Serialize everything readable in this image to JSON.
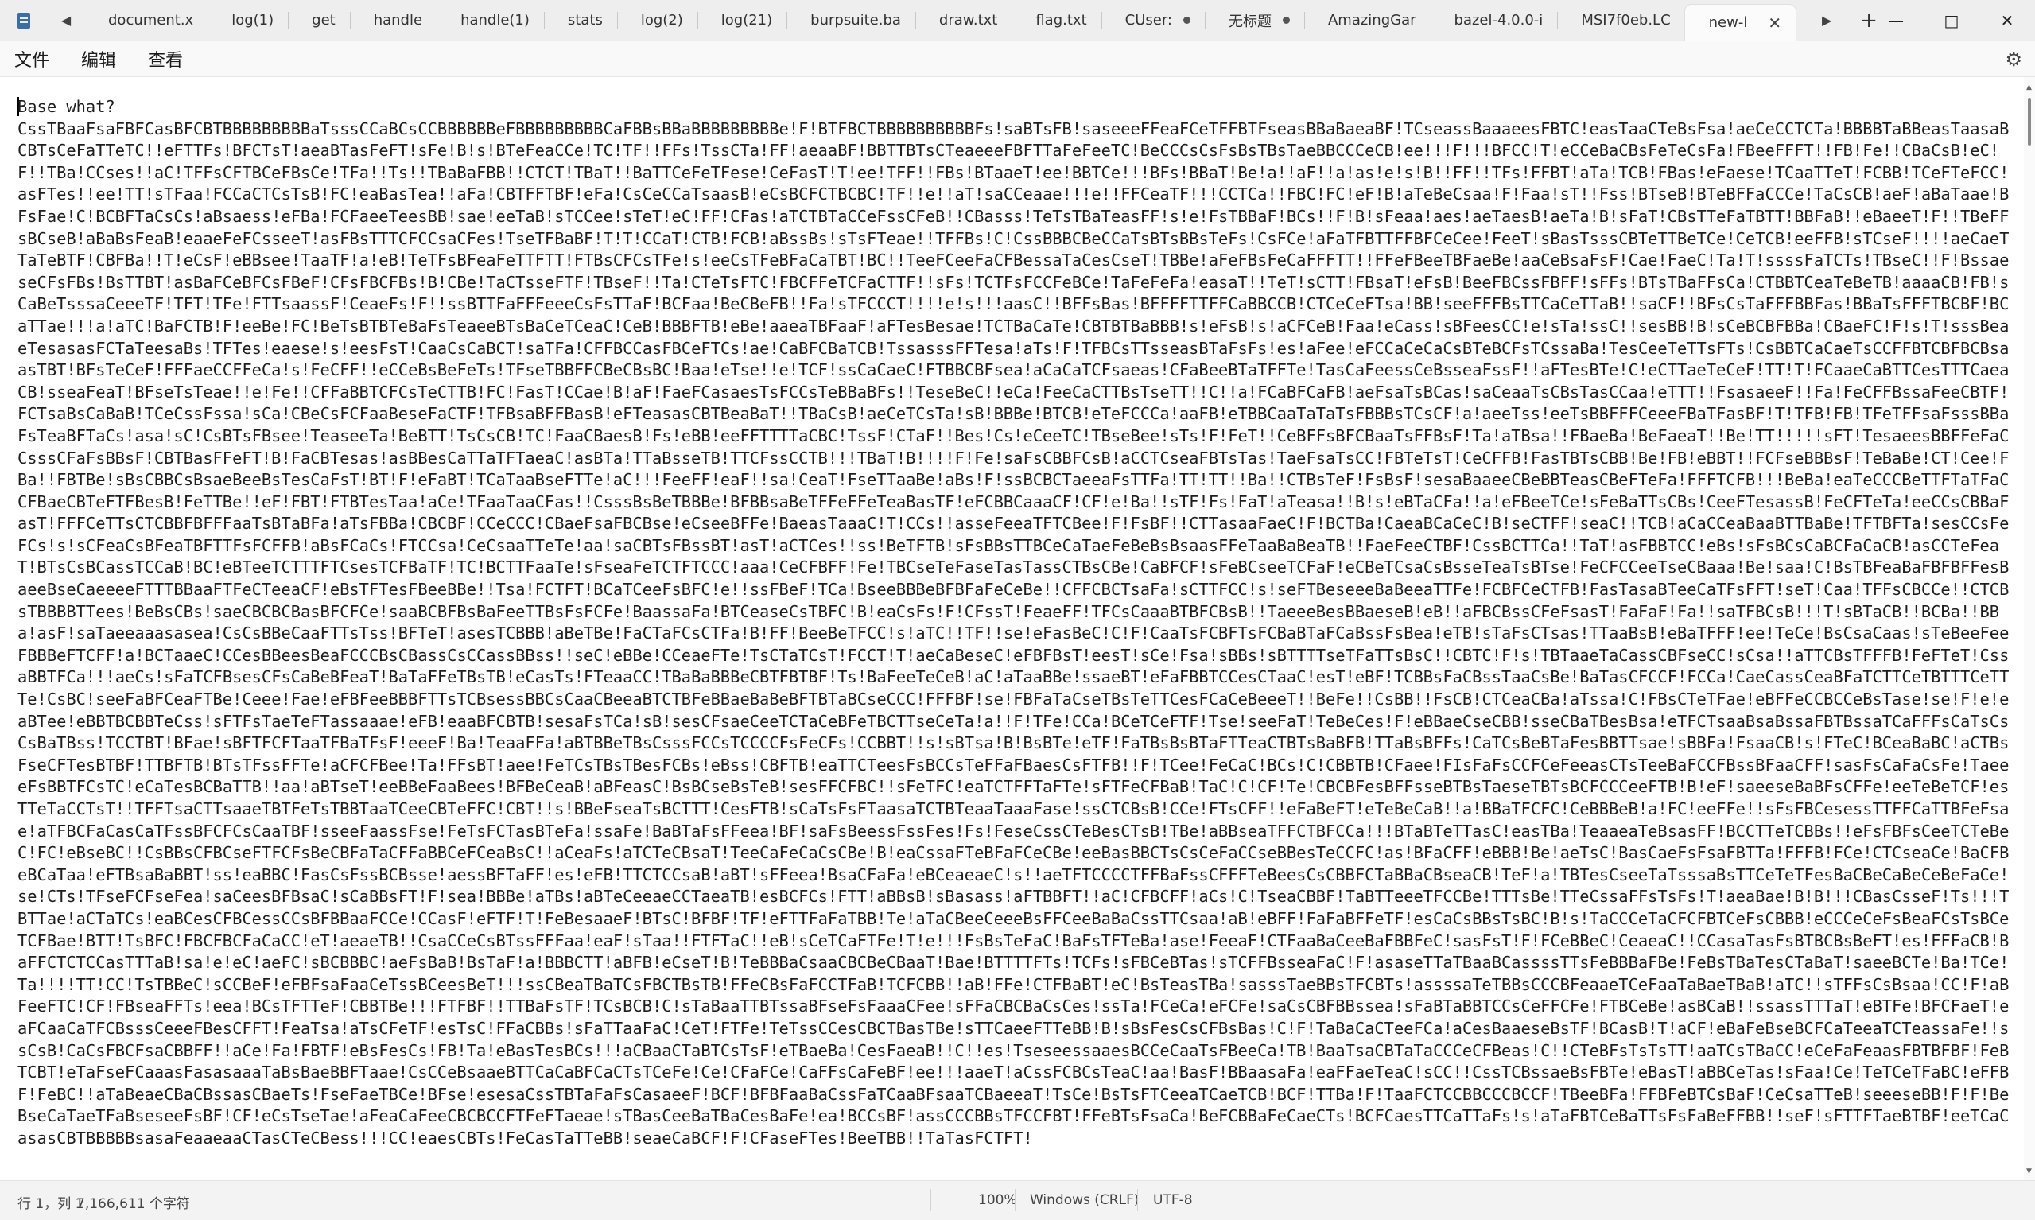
{
  "tabs": [
    {
      "label": "document.x",
      "modified": false
    },
    {
      "label": "log(1)",
      "modified": false
    },
    {
      "label": "get",
      "modified": false
    },
    {
      "label": "handle",
      "modified": false
    },
    {
      "label": "handle(1)",
      "modified": false
    },
    {
      "label": "stats",
      "modified": false
    },
    {
      "label": "log(2)",
      "modified": false
    },
    {
      "label": "log(21)",
      "modified": false
    },
    {
      "label": "burpsuite.ba",
      "modified": false
    },
    {
      "label": "draw.txt",
      "modified": false
    },
    {
      "label": "flag.txt",
      "modified": false
    },
    {
      "label": "CUser:",
      "modified": true
    },
    {
      "label": "无标题",
      "modified": true
    },
    {
      "label": "AmazingGar",
      "modified": false
    },
    {
      "label": "bazel-4.0.0-i",
      "modified": false
    },
    {
      "label": "MSI7f0eb.LC",
      "modified": false
    }
  ],
  "active_tab": {
    "label": "new-l",
    "close_icon": "close-icon"
  },
  "window": {
    "minimize": "—",
    "maximize": "□",
    "close": "✕"
  },
  "menu": {
    "file": "文件",
    "edit": "编辑",
    "view": "查看"
  },
  "editor": {
    "first_line": "Base what?",
    "lines": [
      "CssTBaaFsaFBFCasBFCBTBBBBBBBBBaTsssCCaBCsCCBBBBBBeFBBBBBBBBBCaFBBsBBaBBBBBBBBBe!F!BTFBCTBBBBBBBBBBFs!saBTsFB!saseeeFFeaFCeTFFBTFseasBBaBaeaBF!TCseassBaaaeesFBTC!easTaaCTeBsFsa!aeCeCCTCTa!",
      "BBBBTaBBeasTaasaBCBTsCeFaTTeTC!!eFTTFs!BFCTsT!aeaBTasFeFT!sFe!B!s!BTeFeaCCe!TC!TF!!FFs!TssCTa!FF!aeaaBF!BBTTBTsCTeaeeeFBFTTaFeFeeTC!BeCCCsCsFsBsTBsTaeBBCCCeCB!ee!!!F!!!BFCC!T!eCCeBaCBsFeTeCsFa!FBeeFFFT!!FB!",
      "Fe!!CBaCsB!eC!F!!TBa!CCses!!aC!TFFsCFTBCeFBsCe!TFa!!Ts!!TBaBaFBB!!CTCT!TBaT!!BaTTCeFeTFese!CeFasT!T!ee!TFF!!FBs!BTaaeT!ee!BBTCe!!!BFs!BBaT!Be!a!!aF!!a!as!e!s!B!!FF!!TFs!FFBT!aTa!TCB!FBas!eFaese!TCaaTTeT!FCBB!TCeFTeFCC!",
      "asFTes!!ee!TT!sTFaa!FCCaCTCsTsB!FC!eaBasTea!!aFa!CBTFFTBF!eFa!CsCeCCaTsaasB!eCsBCFCTBCBC!TF!!e!!aT!saCCeaae!!!e!!FFCeaTF!!!CCTCa!!FBC!FC!eF!B!aTeBeCsaa!F!Faa!sT!!Fss!BTseB!BTeBFFaCCCe!TaCsCB!aeF!aBaTaae!BFsFae!C!",
      "BCBFTaCsCs!aBsaess!eFBa!FCFaeeTeesBB!sae!eeTaB!sTCCee!sTeT!eC!FF!CFas!aTCTBTaCCeFssCFeB!!CBasss!TeTsTBaTeasFF!s!e!FsTBBaF!BCs!!F!B!sFeaa!aes!aeTaesB!aeTa!B!sFaT!CBsTTeFaTBTT!BBFaB!!eBaeeT!F!!TBeFFsBCseB!aBaBsFeaB!",
      "eaaeFeFCsseeT!asFBsTTTCFCCsaCFes!TseTFBaBF!T!T!CCaT!CTB!FCB!aBssBs!sTsFTeae!!TFFBs!C!CssBBBCBeCCaTsBTsBBsTeFs!CsFCe!aFaTFBTTFFBFCeCee!FeeT!sBasTsssCBTeTTBeTCe!CeTCB!eeFFB!sTCseF!!!!aeCaeTTaTeBTF!CBFBa!!T!eCsF!",
      "eBBsee!TaaTF!a!eB!TeTFsBFeaFeTTFTT!FTBsCFCsTFe!s!eeCsTFeBFaCaTBT!BC!!TeeFCeeFaCFBessaTaCesCseT!TBBe!aFeFBsFeCaFFFTT!!FFeFBeeTBFaeBe!aaCeBsaFsF!Cae!FaeC!Ta!T!ssssFaTCTs!TBseC!!F!BssaeseCFsFBs!BsTTBT!",
      "asBaFCeBFCsFBeF!CFsFBCFBs!B!CBe!TaCTsseFTF!TBseF!!Ta!CTeTsFTC!FBCFFeTCFaCTTF!!sFs!TCTFsFCCFeBCe!TaFeFeFa!easaT!!TeT!sCTT!FBsaT!eFsB!BeeFBCssFBFF!sFFs!BTsTBaFFsCa!CTBBTCeaTeBeTB!aaaaCB!FB!sCaBeTsssaCeeeTF!TFT!",
      "TFe!FTTsaassF!CeaeFs!F!!ssBTTFaFFFeeeCsFsTTaF!BCFaa!BeCBeFB!!Fa!sTFCCCT!!!!e!s!!!aasC!!BFFsBas!BFFFFTTFFCaBBCCB!CTCeCeFTsa!BB!seeFFFBsTTCaCeTTaB!!saCF!!BFsCsTaFFFBBFas!BBaTsFFFTBCBF!BCaTTae!!!a!aTC!BaFCTB!F!eeBe!FC!",
      "BeTsBTBTeBaFsTeaeeBTsBaCeTCeaC!CeB!BBBFTB!eBe!aaeaTBFaaF!aFTesBesae!TCTBaCaTe!CBTBTBaBBB!s!eFsB!s!aCFCeB!Faa!eCass!sBFeesCC!e!sTa!ssC!!sesBB!B!sCeBCBFBBa!CBaeFC!F!s!T!sssBeaeTesasasFCTaTeesaBs!TFTes!eaese!s!",
      "eesFsT!CaaCsCaBCT!saTFa!CFFBCCasFBCeFTCs!ae!CaBFCBaTCB!TssasssFFTesa!aTs!F!TFBCsTTsseasBTaFsFs!es!aFee!eFCCaCeCaCsBTeBCFsTCssaBa!TesCeeTeTTsFTs!CsBBTCaCaeTsCCFFBTCBFBCBsaasTBT!BFsTeCeF!FFFaeCCFFeCa!s!FeCFF!!",
      "eCCeBsBeFeTs!TFseTBBFFCBeCBsBC!Baa!eTse!!e!TCF!ssCaCaeC!FTBBCBFsea!aCaCaTCFsaeas!CFaBeeBTaTFFTe!TasCaFeessCeBsseaFssF!!aFTesBTe!C!eCTTaeTeCeF!TT!T!FCaaeCaBTTCesTTTCaeaCB!sseaFeaT!BFseTsTeae!!e!Fe!!",
      "CFFaBBTCFCsTeCTTB!FC!FasT!CCae!B!aF!FaeFCasaesTsFCCsTeBBaBFs!!TeseBeC!!eCa!FeeCaCTTBsTseTT!!C!!a!FCaBFCaFB!aeFsaTsBCas!saCeaaTsCBsTasCCaa!eTTT!!FsasaeeF!!Fa!FeCFFBssaFeeCBTF!FCTsaBsCaBaB!TCeCssFssa!sCa!",
      "CBeCsFCFaaBeseFaCTF!TFBsaBFFBasB!eFTeasasCBTBeaBaT!!TBaCsB!aeCeTCsTa!sB!BBBe!BTCB!eTeFCCCa!aaFB!eTBBCaaTaTaTsFBBBsTCsCF!a!aeeTss!eeTsBBFFFCeeeFBaTFasBF!T!TFB!FB!TFeTFFsaFsssBBaFsTeaBFTaCs!asa!sC!CsBTsFBsee!",
      "TeaseeTa!BeBTT!TsCsCB!TC!FaaCBaesB!Fs!eBB!eeFFTTTTaCBC!TssF!CTaF!!Bes!Cs!eCeeTC!TBseBee!sTs!F!FeT!!CeBFFsBFCBaaTsFFBsF!Ta!aTBsa!!FBaeBa!BeFaeaT!!Be!TT!!!!!sFT!TesaeesBBFFeFaCCsssCFaFsBBsF!CBTBasFFeFT!B!FaCBTesas!",
      "asBBesCaTTaTFTaeaC!asBTa!TTaBsseTB!TTCFssCCTB!!!TBaT!B!!!!F!Fe!saFsCBBFCsB!aCCTCseaFBTsTas!TaeFsaTsCC!FBTeTsT!CeCFFB!FasTBTsCBB!Be!FB!eBBT!!FCFseBBBsF!TeBaBe!CT!Cee!FBa!!FBTBe!sBsCBBCsBsaeBeeBsTesCaFsT!BT!F!eFaBT!",
      "TCaTaaBseFTTe!aC!!!FeeFF!eaF!!sa!CeaT!FseTTaaBe!aBs!F!ssBCBCTaeeaFsTTFa!TT!TT!!Ba!!CTBsTeF!FsBsF!sesaBaaeeCBeBBTeasCBeFTeFa!FFFTCFB!!!BeBa!eaTeCCCBeTTFTaTFaCCFBaeCBTeFTFBesB!FeTTBe!!eF!FBT!FTBTesTaa!aCe!",
      "TFaaTaaCFas!!CsssBsBeTBBBe!BFBBsaBeTFFeFFeTeaBasTF!eFCBBCaaaCF!CF!e!Ba!!sTF!Fs!FaT!aTeasa!!B!s!eBTaCFa!!a!eFBeeTCe!sFeBaTTsCBs!CeeFTesassB!FeCFTeTa!eeCCsCBBaFasT!FFFCeTTsCTCBBFBFFFaaTsBTaBFa!aTsFBBa!CBCBF!",
      "CCeCCC!CBaeFsaFBCBse!eCseeBFFe!BaeasTaaaC!T!CCs!!asseFeeaTFTCBee!F!FsBF!!CTTasaaFaeC!F!BCTBa!CaeaBCaCeC!B!seCTFF!seaC!!TCB!aCaCCeaBaaBTTBaBe!TFTBFTa!sesCCsFeFCs!s!sCFeaCsBFeaTBFTTFsFCFFB!aBsFCaCs!FTCCsa!",
      "CeCsaaTTeTe!aa!saCBTsFBssBT!asT!aCTCes!!ss!BeTFTB!sFsBBsTTBCeCaTaeFeBeBsBsaasFFeTaaBaBeaTB!!FaeFeeCTBF!CssBCTTCa!!TaT!asFBBTCC!eBs!sFsBCsCaBCFaCaCB!asCCTeFeaT!BTsCsBCassTCCaB!BC!eBTeeTCTTTFTCsesTCFBaTF!TC!",
      "BCTTFaaTe!sFseaFeTCTFTCCC!aaa!CeCFBFF!Fe!TBCseTeFaseTasTassCTBsCBe!CaBFCF!sFeBCseeTCFaF!eCBeTCsaCsBsseTeaTsBTse!FeCFCCeeTseCBaaa!Be!saa!C!BsTBFeaBaFBFBFFesBaeeBseCaeeeeFTTTBBaaFTFeCTeeaCF!eBsTFTesFBeeBBe!!",
      "Tsa!FCTFT!BCaTCeeFsBFC!e!!ssFBeF!TCa!BseeBBBeBFBFaFeCeBe!!CFFCBCTsaFa!sCTTFCC!s!seFTBeseeeBaBeeaTTFe!FCBFCeCTFB!FasTasaBTeeCaTFsFFT!seT!Caa!TFFsCBCCe!!CTCBsTBBBBTTees!BeBsCBs!saeCBCBCBasBFCFCe!",
      "saaBCBFBsBaFeeTTBsFsFCFe!BaassaFa!BTCeaseCsTBFC!B!eaCsFs!F!CFssT!FeaeFF!TFCsCaaaBTBFCBsB!!TaeeeBesBBaeseB!eB!!aFBCBssCFeFsasT!FaFaF!Fa!!saTFBCsB!!!T!sBTaCB!!BCBa!!BBa!asF!saTaeeaaasasea!CsCsBBeCaaFTTsTss!BFTeT!",
      "asesTCBBB!aBeTBe!FaCTaFCsCTFa!B!FF!BeeBeTFCC!s!aTC!!TF!!se!eFasBeC!C!F!CaaTsFCBFTsFCBaBTaFCaBssFsBea!eTB!sTaFsCTsas!TTaaBsB!eBaTFFF!ee!TeCe!BsCsaCaas!sTeBeeFeeFBBBeFTCFF!a!BCTaaeC!",
      "CCesBBeesBeaFCCCBsCBassCsCCassBBss!!seC!eBBe!CCeaeFTe!TsCTaTCsT!FCCT!T!aeCaBeseC!eFBFBsT!eesT!sCe!Fsa!sBBs!sBTTTTseTFaTTsBsC!!CBTC!F!s!TBTaaeTaCassCBFseCC!sCsa!!aTTCBsTFFFB!FeFTeT!CssaBBTFCa!!!aeCs!",
      "sFaTCFBsesCFsCaBeBFeaT!BaTaFFeTBsTB!eCasTs!FTeaaCC!TBaBaBBBeCBTFBTBF!Ts!BaFeeTeCeB!aC!aTaaBBe!ssaeBT!eFaFBBTCCesCTaaC!esT!eBF!TCBBsFaCBssTaaCsBe!BaTasCFCCF!FCCa!CaeCassCeaBFaTCTTCeTBTTTCeTTTe!CsBC!",
      "seeFaBFCeaFTBe!Ceee!Fae!eFBFeeBBBFTTsTCBsessBBCsCaaCBeeaBTCTBFeBBaeBaBeBFTBTaBCseCCC!FFFBF!se!FBFaTaCseTBsTeTTCesFCaCeBeeeT!!BeFe!!CsBB!!FsCB!CTCeaCBa!aTssa!C!FBsCTeTFae!eBFFeCCBCCeBsTase!se!F!e!eaBTee!",
      "eBBTBCBBTeCss!sFTFsTaeTeFTassaaae!eFB!eaaBFCBTB!sesaFsTCa!sB!sesCFsaeCeeTCTaCeBFeTBCTTseCeTa!a!!F!TFe!CCa!BCeTCeFTF!Tse!seeFaT!TeBeCes!F!eBBaeCseCBB!sseCBaTBesBsa!eTFCTsaaBsaBssaFBTBssaTCaFFFsCaTsCsCsBaTBss!",
      "TCCTBT!BFae!sBFTFCFTaaTFBaTFsF!eeeF!Ba!TeaaFFa!aBTBBeTBsCsssFCCsTCCCCFsFeCFs!CCBBT!!s!sBTsa!B!BsBTe!eTF!FaTBsBsBTaFTTeaCTBTsBaBFB!TTaBsBFFs!CaTCsBeBTaFesBBTTsae!sBBFa!FsaaCB!s!FTeC!BCeaBaBC!aCTBsFseCFTesBTBF!",
      "TTBFTB!BTsTFssFFTe!aCFCFBee!Ta!FFsBT!aee!FeTCsTBsTBesFCBs!eBss!CBFTB!eaTTCTeesFsBCCsTeFFaFBaesCsFTFB!!F!TCee!FeCaC!BCs!C!CBBTB!CFaee!FIsFaFsCCFCeFeeasCTsTeeBaFCCFBssBFaaCFF!sasFsCaFaCsFe!TaeeeFsBBTFCsTC!",
      "eCaTesBCBaTTB!!aa!aBTseT!eeBBeFaaBees!BFBeCeaB!aBFeasC!BsBCseBsTeB!sesFFCFBC!!sFeTFC!eaTCTFFTaFTe!sFTFeCFBaB!TaC!C!CF!Te!CBCBFesBFFsseBTBsTaeseTBTsBCFCCCeeFTB!B!eF!saeeseBaBFsCFFe!eeTeBeTCF!esTTeTaCCTsT!!",
      "TFFTsaCTTsaaeTBTFeTsTBBTaaTCeeCBTeFFC!CBT!!s!BBeFseaTsBCTTT!CesFTB!sCaTsFsFTaasaTCTBTeaaTaaaFase!ssCTCBsB!CCe!FTsCFF!!eFaBeFT!eTeBeCaB!!a!BBaTFCFC!CeBBBeB!a!FC!eeFFe!!sFsFBCesessTTFFCaTTBFeFsae!",
      "aTFBCFaCasCaTFssBFCFCsCaaTBF!sseeFaassFse!FeTsFCTasBTeFa!ssaFe!BaBTaFsFFeea!BF!saFsBeessFssFes!Fs!FeseCssCTeBesCTsB!TBe!aBBseaTFFCTBFCCa!!!BTaBTeTTasC!easTBa!TeaaeaTeBsasFF!BCCTTeTCBBs!!eFsFBFsCeeTCTeBeC!FC!",
      "eBseBC!!CsBBsCFBCseFTFCFsBeCBFaTaCFFaBBCeFCeaBsC!!aCeaFs!aTCTeCBsaT!TeeCaFeCaCsCBe!B!eaCssaFTeBFaFCeCBe!eeBasBBCTsCsCeFaCCseBBesTeCCFC!as!BFaCFF!eBBB!Be!aeTsC!BasCaeFsFsaFBTTa!FFFB!FCe!CTCseaCe!",
      "BaCFBeBCaTaa!eFTBsaBaBBT!ss!eaBBC!FasCsFssBCBsse!aessBFTaFF!es!eFB!TTCTCCsaB!aBT!sFFeea!BsaCFaFa!eBCeaeaeC!s!!aeTFTCCCCTFFBaFssCFFFTeBeesCsCBBFCTaBBaCBseaCB!TeF!a!",
      "TBTesCseeTaTsssaBsTTCeTeTFesBaCBeCaBeCeBeFaCe!se!CTs!TFseFCFseFea!saCeesBFBsaC!sCaBBsFT!F!sea!BBBe!aTBs!aBTeCeeaeCCTaeaTB!esBCFCs!FTT!aBBsB!sBasass!aFTBBFT!!aC!CFBCFF!aCs!C!TseaCBBF!TaBTTeeeTFCCBe!TTTsBe!",
      "TTeCssaFFsTsFs!T!aeaBae!B!B!!!CBasCsseF!Ts!!!TBTTae!aCTaTCs!eaBCesCFBCessCCsBFBBaaFCCe!CCasF!eFTF!T!FeBesaaeF!BTsC!BFBF!TF!eFTTFaFaTBB!Te!aTaCBeeCeeeBsFFCeeBaBaCssTTCsaa!aB!eBFF!FaFaBFFeTF!esCaCsBBsTsBC!B!s!",
      "TaCCCeTaCFCFBTCeFsCBBB!eCCCeCeFsBeaFCsTsBCeTCFBae!BTT!TsBFC!FBCFBCFaCaCC!eT!aeaeTB!!CsaCCeCsBTssFFFaa!eaF!sTaa!!FTFTaC!!eB!sCeTCaFTFe!T!e!!!FsBsTeFaC!BaFsTFTeBa!ase!FeeaF!CTFaaBaCeeBaFBBFeC!sasFsT!F!FCeBBeC!",
      "CeaeaC!!CCasaTasFsBTBCBsBeFT!es!FFFaCB!BaFFCTCTCCasTTTaB!sa!e!eC!aeFC!sBCBBBC!aeFsBaB!BsTaF!a!BBBCTT!aBFB!eCseT!B!TeBBBaCsaaCBCBeCBaaT!Bae!BTTTTFTs!TCFs!sFBCeBTas!sTCFFBsseaFaC!F!",
      "asaseTTaTBaaBCassssTTsFeBBBaFBe!FeBsTBaTesCTaBaT!saeeBCTe!Ba!TCe!Ta!!!!TT!CC!TsTBBeC!sCCBeF!eFBFsaFaaCeTssBCeesBeT!!!ssCBeaTBaTCsFBCTBsTB!FFeCBsFaFCCTFaB!TCFCBB!!aB!FFe!CTFBaBT!eC!BsTeasTBa!sasssTaeBBsTFCBTs!",
      "assssaTeTBBsCCCBFeaaeTCeFaaTaBaeTBaB!aTC!!sTFFsCsBsaa!CC!F!aBFeeFTC!CF!FBseaFFTs!eea!BCsTFTTeF!CBBTBe!!!FTFBF!!TTBaFsTF!TCsBCB!C!sTaBaaTTBTssaBFseFsFaaaCFee!sFFaCBCBaCsCes!ssTa!FCeCa!eFCFe!saCsCBFBBssea!",
      "sFaBTaBBTCCsCeFFCFe!FTBCeBe!asBCaB!!ssassTTTaT!eBTFe!BFCFaeT!eaFCaaCaTFCBsssCeeeFBesCFFT!FeaTsa!aTsCFeTF!esTsC!FFaCBBs!sFaTTaaFaC!CeT!FTFe!TeTssCCesCBCTBasTBe!sTTCaeeFTTeBB!B!sBsFesCsCFBsBas!C!F!",
      "TaBaCaCTeeFCa!aCesBaaeseBsTF!BCasB!T!aCF!eBaFeBseBCFCaTeeaTCTeassaFe!!ssCsB!CaCsFBCFsaCBBFF!!aCe!Fa!FBTF!eBsFesCs!FB!Ta!eBasTesBCs!!!aCBaaCTaBTCsTsF!eTBaeBa!CesFaeaB!!C!!es!TseseessaaesBCCeCaaTsFBeeCa!TB!",
      "BaaTsaCBTaTaCCCeCFBeas!C!!CTeBFsTsTsTT!aaTCsTBaCC!eCeFaFeaasFBTBFBF!FeBTCBT!eTaFseFCaaasFasasaaaTaBsBaeBBFTaae!CsCCeBsaaeBTTCaCaBFCaCTsTCeFe!Ce!CFaFCe!CaFFsCaFeBF!ee!!!aaeT!aCssFCBCsTeaC!aa!BasF!BBaasaFa!",
      "eaFFaeTeaC!sCC!!CssTCBssaeBsFBTe!eBasT!aBBCeTas!sFaa!Ce!TeTCeTFaBC!eFFBF!FeBC!!aTaBeaeCBaCBssasCBaeTs!FseFaeTBCe!BFse!esesaCssTBTaFaFsCasaeeF!BCF!BFBFaaBaCssFaTCaaBFsaaTCBaeeaT!TsCe!BsTsFTCeeaTCaeTCB!BCF!",
      "TTBa!F!TaaFCTCCBBCCCBCCF!TBeeBFa!FFBFeBTCsBaF!CeCsaTTeB!seeeseBB!F!F!BeBseCaTaeTFaBseseeFsBF!CF!eCsTseTae!aFeaCaFeeCBCBCCFTFeFTaeae!sTBasCeeBaTBaCesBaFe!ea!BCCsBF!assCCCBBsTFCCFBT!FFeBTsFsaCa!",
      "BeFCBBaFeCaeCTs!BCFCaesTTCaTTaFs!s!aTaFBTCeBaTTsFsFaBeFFBB!!seF!sFTTFTaeBTBF!eeTCaCasasCBTBBBBBsasaFeaaeaaCTasCTeCBess!!!CC!eaesCBTs!FeCasTaTTeBB!seaeCaBCF!F!CFaseFTes!BeeTBB!!TaTasFCTFT!"
    ]
  },
  "status": {
    "position": "行 1，列 1",
    "chars": "7,166,611 个字符",
    "zoom": "100%",
    "line_ending": "Windows (CRLF)",
    "encoding": "UTF-8"
  }
}
